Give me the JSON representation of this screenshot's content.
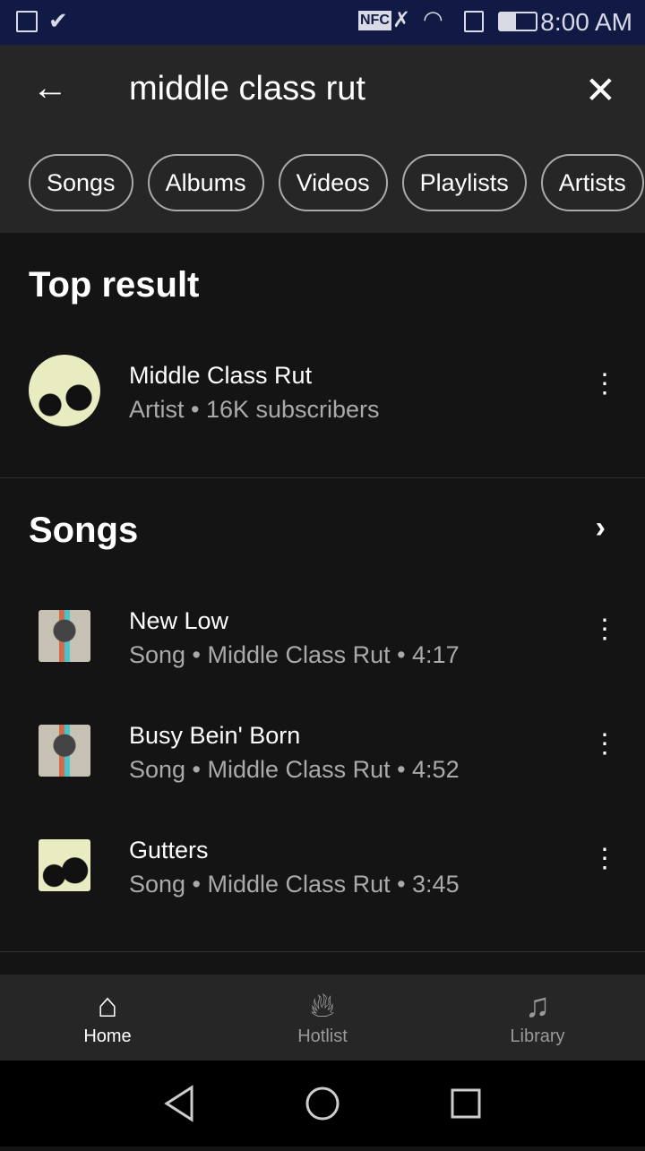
{
  "status_bar": {
    "time": "8:00 AM",
    "icons": [
      "gallery-icon",
      "check-icon",
      "nfc-icon",
      "mute-icon",
      "wifi-icon",
      "sim-alert-icon",
      "battery-icon"
    ]
  },
  "search": {
    "query": "middle class rut"
  },
  "filters": [
    "Songs",
    "Albums",
    "Videos",
    "Playlists",
    "Artists"
  ],
  "top_result": {
    "heading": "Top result",
    "name": "Middle Class Rut",
    "subtitle": "Artist • 16K subscribers"
  },
  "songs": {
    "heading": "Songs",
    "items": [
      {
        "title": "New Low",
        "subtitle": "Song • Middle Class Rut • 4:17"
      },
      {
        "title": "Busy Bein' Born",
        "subtitle": "Song • Middle Class Rut • 4:52"
      },
      {
        "title": "Gutters",
        "subtitle": "Song • Middle Class Rut • 3:45"
      }
    ]
  },
  "bottom_nav": [
    {
      "label": "Home",
      "active": true
    },
    {
      "label": "Hotlist"
    },
    {
      "label": "Library"
    }
  ]
}
